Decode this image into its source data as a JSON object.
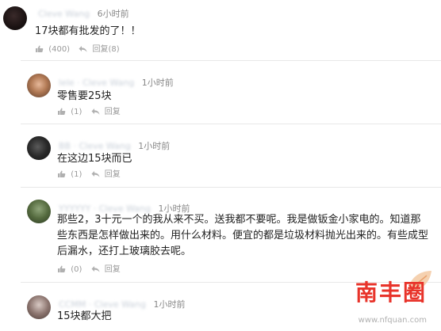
{
  "comments": [
    {
      "user": "Cleve Wang",
      "time": "6小时前",
      "text": "17块都有批发的了！！",
      "like_count": "(400)",
      "reply_label": "回复",
      "reply_count": "(8)"
    },
    {
      "user": "lele · Cleve Wang",
      "time": "1小时前",
      "text": "零售要25块",
      "like_count": "(1)",
      "reply_label": "回复",
      "reply_count": ""
    },
    {
      "user": "BB · Cleve Wang",
      "time": "1小时前",
      "text": "在这边15块而已",
      "like_count": "(1)",
      "reply_label": "回复",
      "reply_count": ""
    },
    {
      "user": "YYYYYY · Cleve Wang",
      "time": "1小时前",
      "text": "那些2，3十元一个的我从来不买。送我都不要呢。我是做钣金小家电的。知道那些东西是怎样做出来的。用什么材料。便宜的都是垃圾材料抛光出来的。有些成型后漏水，还打上玻璃胶去呢。",
      "like_count": "(0)",
      "reply_label": "回复",
      "reply_count": ""
    },
    {
      "user": "CCMM · Cleve Wang",
      "time": "1小时前",
      "text": "15块都大把",
      "like_count": "(0)",
      "reply_label": "回复",
      "reply_count": ""
    }
  ],
  "watermark": {
    "title": "南丰圈",
    "url": "www.nfquan.com",
    "color": "#e8332a"
  },
  "icons": {
    "like": "thumbs-up-icon",
    "reply": "reply-arrow-icon"
  }
}
